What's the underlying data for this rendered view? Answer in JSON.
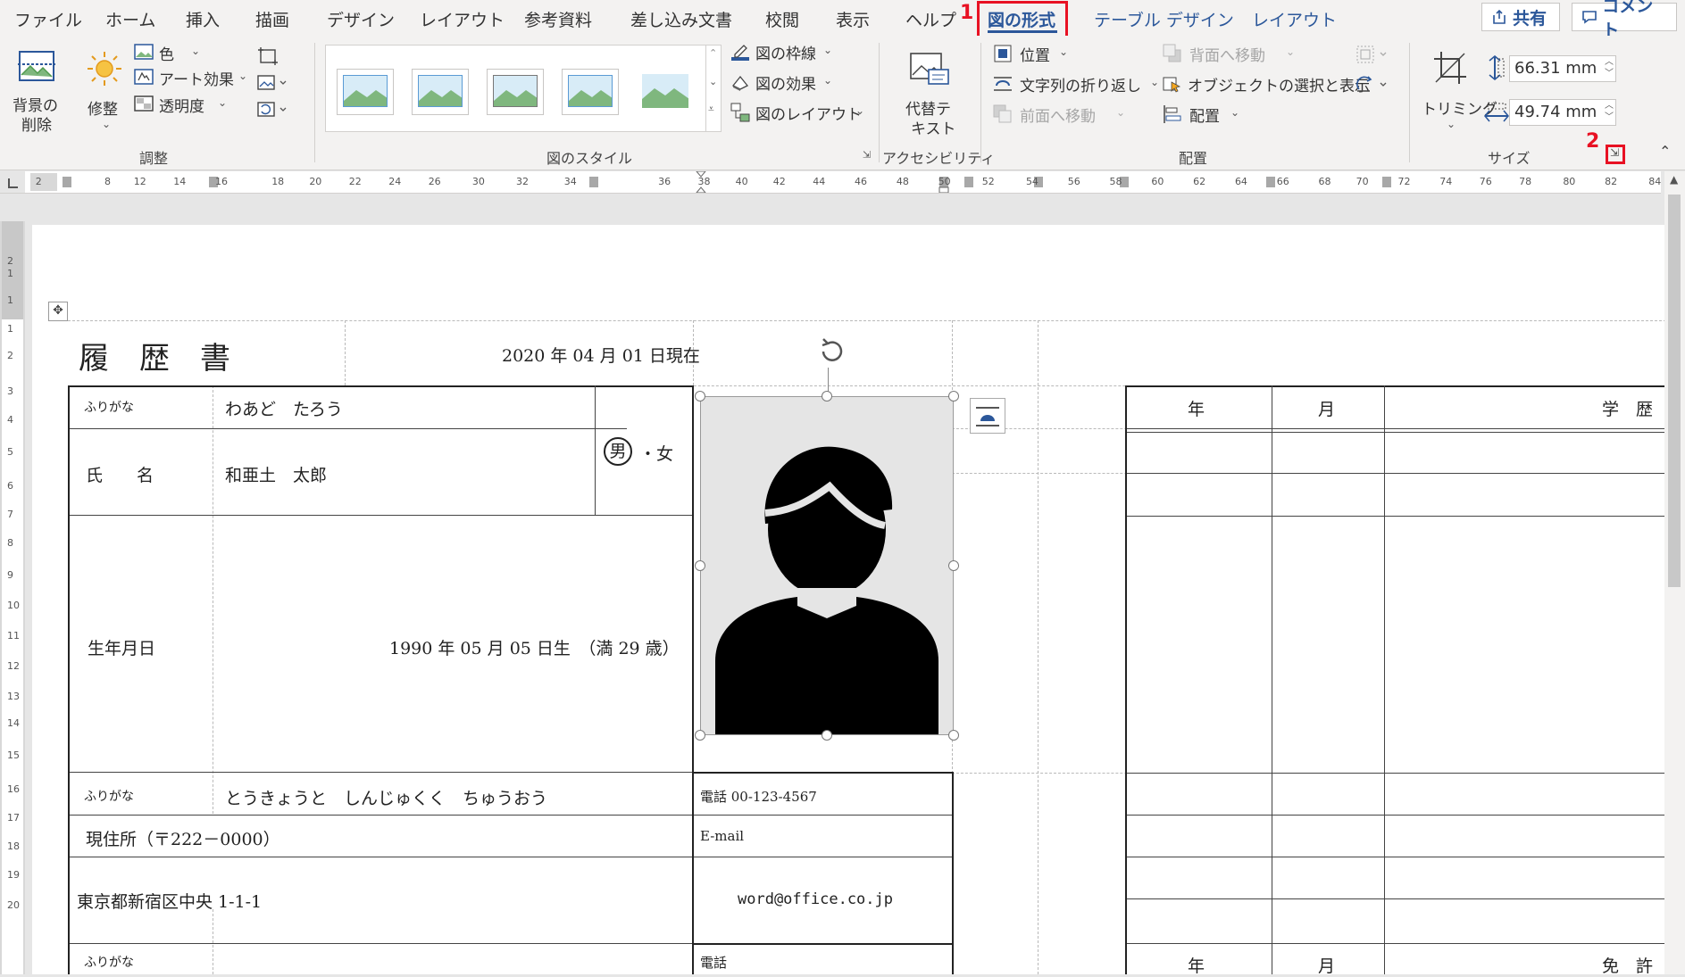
{
  "tabs": [
    {
      "label": "ファイル"
    },
    {
      "label": "ホーム"
    },
    {
      "label": "挿入"
    },
    {
      "label": "描画"
    },
    {
      "label": "デザイン"
    },
    {
      "label": "レイアウト"
    },
    {
      "label": "参考資料"
    },
    {
      "label": "差し込み文書"
    },
    {
      "label": "校閲"
    },
    {
      "label": "表示"
    },
    {
      "label": "ヘルプ"
    },
    {
      "label": "図の形式"
    },
    {
      "label": "テーブル デザイン"
    },
    {
      "label": "レイアウト"
    }
  ],
  "annotations": {
    "step1": "1",
    "step2": "2"
  },
  "share_label": "共有",
  "comment_label": "コメント",
  "ribbon": {
    "remove_bg": [
      "背景の",
      "削除"
    ],
    "corrections": "修整",
    "color": "色",
    "art_effects": "アート効果",
    "transparency": "透明度",
    "adjust_group": "調整",
    "picture_styles_group": "図のスタイル",
    "border": "図の枠線",
    "effects": "図の効果",
    "layout": "図のレイアウト",
    "alt_text": [
      "代替テ",
      "キスト"
    ],
    "accessibility_group": "アクセシビリティ",
    "position": "位置",
    "wrap_text": "文字列の折り返し",
    "bring_forward": "前面へ移動",
    "send_backward": "背面へ移動",
    "selection_pane": "オブジェクトの選択と表示",
    "align": "配置",
    "arrange_group": "配置",
    "crop": "トリミング",
    "height": "66.31 mm",
    "width": "49.74 mm",
    "size_group": "サイズ"
  },
  "ruler_labels": [
    "2",
    "8",
    "12",
    "14",
    "16",
    "18",
    "20",
    "22",
    "24",
    "26",
    "30",
    "32",
    "34",
    "36",
    "38",
    "40",
    "42",
    "44",
    "46",
    "48",
    "50",
    "52",
    "54",
    "56",
    "58",
    "60",
    "62",
    "64",
    "66",
    "68",
    "70",
    "72",
    "74",
    "76",
    "78",
    "80",
    "82",
    "84"
  ],
  "vruler_labels": [
    "2",
    "1",
    "1",
    "1",
    "2",
    "3",
    "4",
    "5",
    "6",
    "7",
    "8",
    "9",
    "10",
    "11",
    "12",
    "13",
    "14",
    "15",
    "16",
    "17",
    "18",
    "19",
    "20"
  ],
  "resume": {
    "title": "履　歴　書",
    "date": "2020 年 04 月 01 日現在",
    "furigana_label": "ふりがな",
    "furigana_value": "わあど　たろう",
    "name_label": "氏　　名",
    "name_value": "和亜土　太郎",
    "gender_male": "男",
    "gender_rest": "・女",
    "birth_label": "生年月日",
    "birth_value": "1990 年 05 月 05 日生　（満 29 歳）",
    "addr_furigana_label": "ふりがな",
    "addr_furigana_value": "とうきょうと　しんじゅくく　ちゅうおう",
    "addr_label": "現住所（〒222－0000）",
    "addr_value": "東京都新宿区中央 1-1-1",
    "phone": "電話 00-123-4567",
    "email_label": "E-mail",
    "email_value": "word@office.co.jp",
    "furigana_label2": "ふりがな",
    "phone_label2": "電話",
    "edu_year": "年",
    "edu_month": "月",
    "edu_title": "学　歴",
    "lic_year": "年",
    "lic_month": "月",
    "lic_title": "免　許"
  }
}
